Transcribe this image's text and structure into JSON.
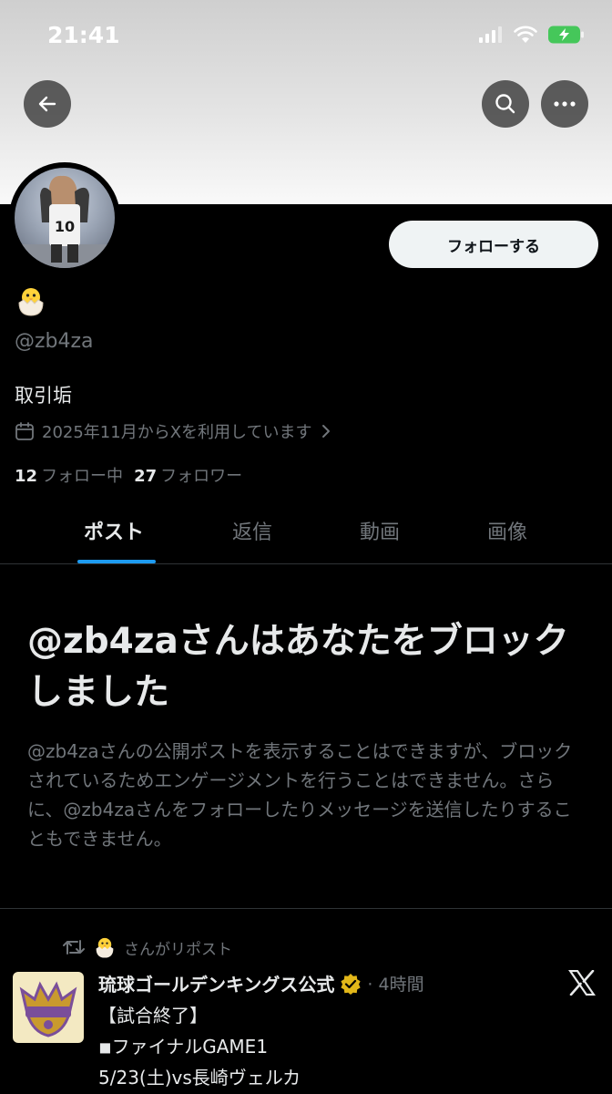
{
  "status_bar": {
    "time": "21:41"
  },
  "profile": {
    "display_name_emoji": "🐣",
    "handle": "@zb4za",
    "bio": "取引垢",
    "joined": "2025年11月からXを利用しています",
    "following_count": "12",
    "following_label": "フォロー中",
    "followers_count": "27",
    "followers_label": "フォロワー",
    "follow_button": "フォローする"
  },
  "tabs": [
    {
      "label": "ポスト"
    },
    {
      "label": "返信"
    },
    {
      "label": "動画"
    },
    {
      "label": "画像"
    }
  ],
  "blocked": {
    "title": "@zb4zaさんはあなたをブロックしました",
    "description": "@zb4zaさんの公開ポストを表示することはできますが、ブロックされているためエンゲージメントを行うことはできません。さらに、@zb4zaさんをフォローしたりメッセージを送信したりすることもできません。"
  },
  "post": {
    "repost_emoji": "🐣",
    "repost_text": "さんがリポスト",
    "author": "琉球ゴールデンキングス公式",
    "time": "4時間",
    "lines": [
      "【試合終了】",
      "◾︎ファイナルGAME1",
      "5/23(土)vs長崎ヴェルカ"
    ]
  },
  "colors": {
    "background": "#000000",
    "accent": "#1d9bf0",
    "muted_text": "#71767b",
    "verified": "#e2b719"
  },
  "icons": [
    "back-arrow-icon",
    "search-icon",
    "more-icon",
    "calendar-icon",
    "chevron-right-icon",
    "repost-icon",
    "verified-badge-icon",
    "x-logo-icon",
    "signal-icon",
    "wifi-icon",
    "battery-icon"
  ]
}
